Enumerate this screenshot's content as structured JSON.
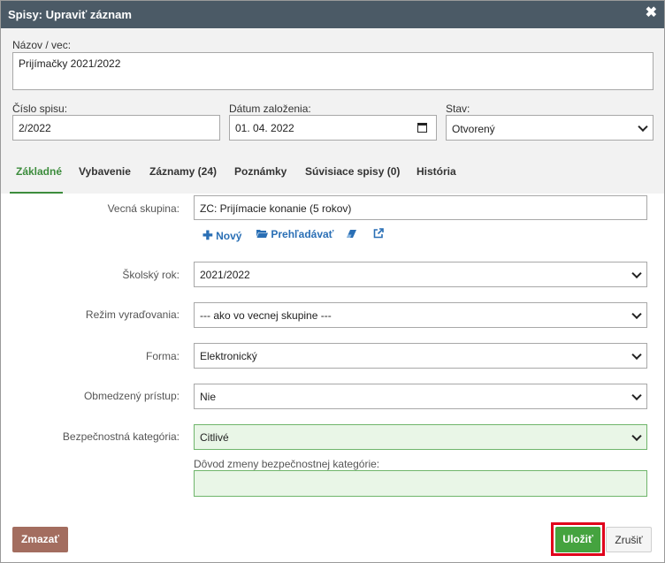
{
  "dialog": {
    "title": "Spisy: Upraviť záznam",
    "close_glyph": "✖"
  },
  "top": {
    "name_label": "Názov / vec:",
    "name_value": "Prijímačky 2021/2022",
    "file_no_label": "Číslo spisu:",
    "file_no_value": "2/2022",
    "date_label": "Dátum založenia:",
    "date_value": "01. 04. 2022",
    "state_label": "Stav:",
    "state_value": "Otvorený"
  },
  "tabs": [
    {
      "label": "Základné"
    },
    {
      "label": "Vybavenie"
    },
    {
      "label": "Záznamy (24)"
    },
    {
      "label": "Poznámky"
    },
    {
      "label": "Súvisiace spisy (0)"
    },
    {
      "label": "História"
    }
  ],
  "form": {
    "subject_group_label": "Vecná skupina:",
    "subject_group_value": "ZC: Prijímacie konanie (5 rokov)",
    "new_link": "Nový",
    "browse_link": "Prehľadávať",
    "school_year_label": "Školský rok:",
    "school_year_value": "2021/2022",
    "discard_mode_label": "Režim vyraďovania:",
    "discard_mode_value": "--- ako vo vecnej skupine ---",
    "form_label": "Forma:",
    "form_value": "Elektronický",
    "restricted_label": "Obmedzený prístup:",
    "restricted_value": "Nie",
    "security_label": "Bezpečnostná kategória:",
    "security_value": "Citlivé",
    "reason_label": "Dôvod zmeny bezpečnostnej kategórie:",
    "reason_value": ""
  },
  "buttons": {
    "delete": "Zmazať",
    "save": "Uložiť",
    "cancel": "Zrušiť"
  },
  "colors": {
    "titlebar": "#4b5a66",
    "accent_green": "#45a33f",
    "delete": "#a36d5f",
    "link": "#2a6fb5",
    "highlight": "#e0001b"
  }
}
